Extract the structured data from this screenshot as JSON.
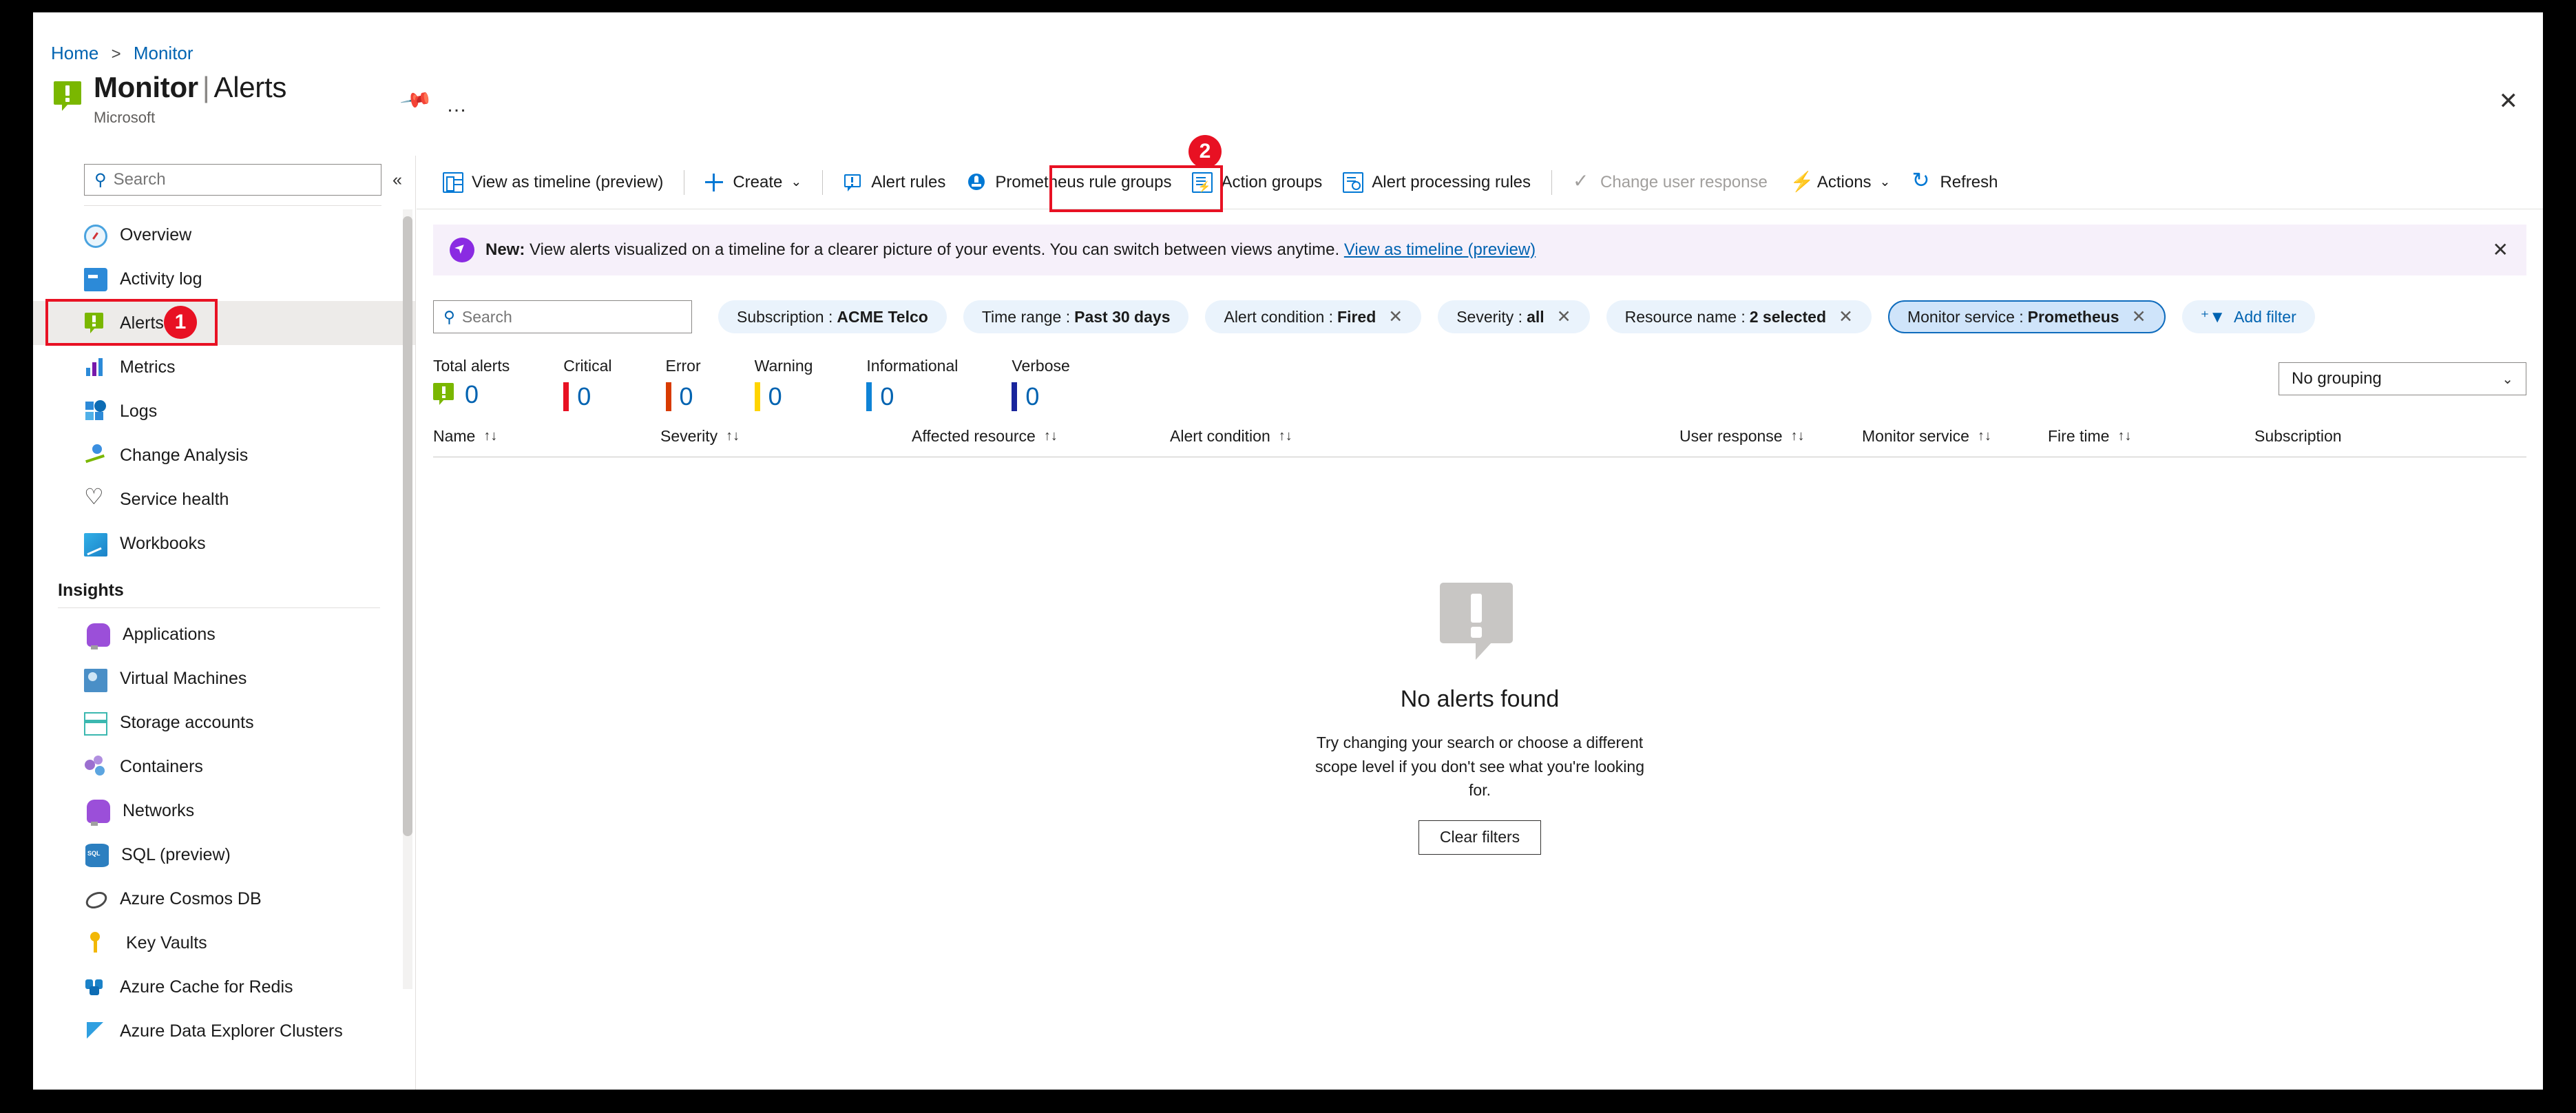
{
  "breadcrumb": {
    "home": "Home",
    "separator": ">",
    "current": "Monitor"
  },
  "header": {
    "title": "Monitor",
    "divider": "|",
    "subtitle_page": "Alerts",
    "publisher": "Microsoft",
    "pin_icon": "pin-icon",
    "ellipsis": "…",
    "close": "✕"
  },
  "sidebar": {
    "search_placeholder": "Search",
    "collapse_label": "«",
    "items": [
      {
        "label": "Overview",
        "icon": "overview-icon",
        "selected": false
      },
      {
        "label": "Activity log",
        "icon": "activity-log-icon",
        "selected": false
      },
      {
        "label": "Alerts",
        "icon": "alerts-icon",
        "selected": true
      },
      {
        "label": "Metrics",
        "icon": "metrics-icon",
        "selected": false
      },
      {
        "label": "Logs",
        "icon": "logs-icon",
        "selected": false
      },
      {
        "label": "Change Analysis",
        "icon": "change-analysis-icon",
        "selected": false
      },
      {
        "label": "Service health",
        "icon": "service-health-icon",
        "selected": false
      },
      {
        "label": "Workbooks",
        "icon": "workbooks-icon",
        "selected": false
      }
    ],
    "section_insights": "Insights",
    "insights_items": [
      {
        "label": "Applications",
        "icon": "applications-icon"
      },
      {
        "label": "Virtual Machines",
        "icon": "virtual-machines-icon"
      },
      {
        "label": "Storage accounts",
        "icon": "storage-accounts-icon"
      },
      {
        "label": "Containers",
        "icon": "containers-icon"
      },
      {
        "label": "Networks",
        "icon": "networks-icon"
      },
      {
        "label": "SQL (preview)",
        "icon": "sql-icon"
      },
      {
        "label": "Azure Cosmos DB",
        "icon": "cosmos-db-icon"
      },
      {
        "label": "Key Vaults",
        "icon": "key-vaults-icon"
      },
      {
        "label": "Azure Cache for Redis",
        "icon": "redis-icon"
      },
      {
        "label": "Azure Data Explorer Clusters",
        "icon": "data-explorer-icon"
      }
    ]
  },
  "toolbar": {
    "view_timeline": "View as timeline (preview)",
    "create": "Create",
    "alert_rules": "Alert rules",
    "prometheus_rule_groups": "Prometheus rule groups",
    "action_groups": "Action groups",
    "alert_processing_rules": "Alert processing rules",
    "change_user_response": "Change user response",
    "actions": "Actions",
    "refresh": "Refresh",
    "chevron": "⌄"
  },
  "banner": {
    "prefix": "New:",
    "message": "View alerts visualized on a timeline for a clearer picture of your events. You can switch between views anytime.",
    "link": "View as timeline (preview)",
    "close": "✕"
  },
  "filters": {
    "search_placeholder": "Search",
    "chips": [
      {
        "label": "Subscription :",
        "value": "ACME Telco",
        "closable": false,
        "active": false
      },
      {
        "label": "Time range :",
        "value": "Past 30 days",
        "closable": false,
        "active": false
      },
      {
        "label": "Alert condition :",
        "value": "Fired",
        "closable": true,
        "active": false
      },
      {
        "label": "Severity :",
        "value": "all",
        "closable": true,
        "active": false
      },
      {
        "label": "Resource name :",
        "value": "2 selected",
        "closable": true,
        "active": false
      },
      {
        "label": "Monitor service :",
        "value": "Prometheus",
        "closable": true,
        "active": true
      }
    ],
    "add_filter": "Add filter",
    "close_glyph": "✕"
  },
  "summary": [
    {
      "label": "Total alerts",
      "value": "0",
      "color": "#7ab700",
      "kind": "badge"
    },
    {
      "label": "Critical",
      "value": "0",
      "color": "#e81123",
      "kind": "bar"
    },
    {
      "label": "Error",
      "value": "0",
      "color": "#d83b01",
      "kind": "bar"
    },
    {
      "label": "Warning",
      "value": "0",
      "color": "#ffd400",
      "kind": "bar"
    },
    {
      "label": "Informational",
      "value": "0",
      "color": "#0f83d6",
      "kind": "bar"
    },
    {
      "label": "Verbose",
      "value": "0",
      "color": "#19259c",
      "kind": "bar"
    }
  ],
  "grouping": {
    "value": "No grouping",
    "chevron": "⌄"
  },
  "table": {
    "columns": [
      {
        "label": "Name",
        "sortable": true
      },
      {
        "label": "Severity",
        "sortable": true
      },
      {
        "label": "Affected resource",
        "sortable": true
      },
      {
        "label": "Alert condition",
        "sortable": true
      },
      {
        "label": "User response",
        "sortable": true
      },
      {
        "label": "Monitor service",
        "sortable": true
      },
      {
        "label": "Fire time",
        "sortable": true
      },
      {
        "label": "Subscription",
        "sortable": false
      }
    ],
    "sort_glyph": "↑↓",
    "rows": []
  },
  "empty_state": {
    "title": "No alerts found",
    "message": "Try changing your search or choose a different scope level if you don't see what you're looking for.",
    "button": "Clear filters"
  },
  "annotations": [
    {
      "step": "1",
      "target": "sidebar-item-alerts"
    },
    {
      "step": "2",
      "target": "toolbar-prometheus-rule-groups"
    }
  ],
  "colors": {
    "accent": "#0078d4",
    "link": "#0063b1",
    "highlight": "#e81123",
    "chip_bg": "#eaf3fc",
    "chip_active_bg": "#cfe4fa",
    "banner_bg": "#f6f0fa"
  }
}
